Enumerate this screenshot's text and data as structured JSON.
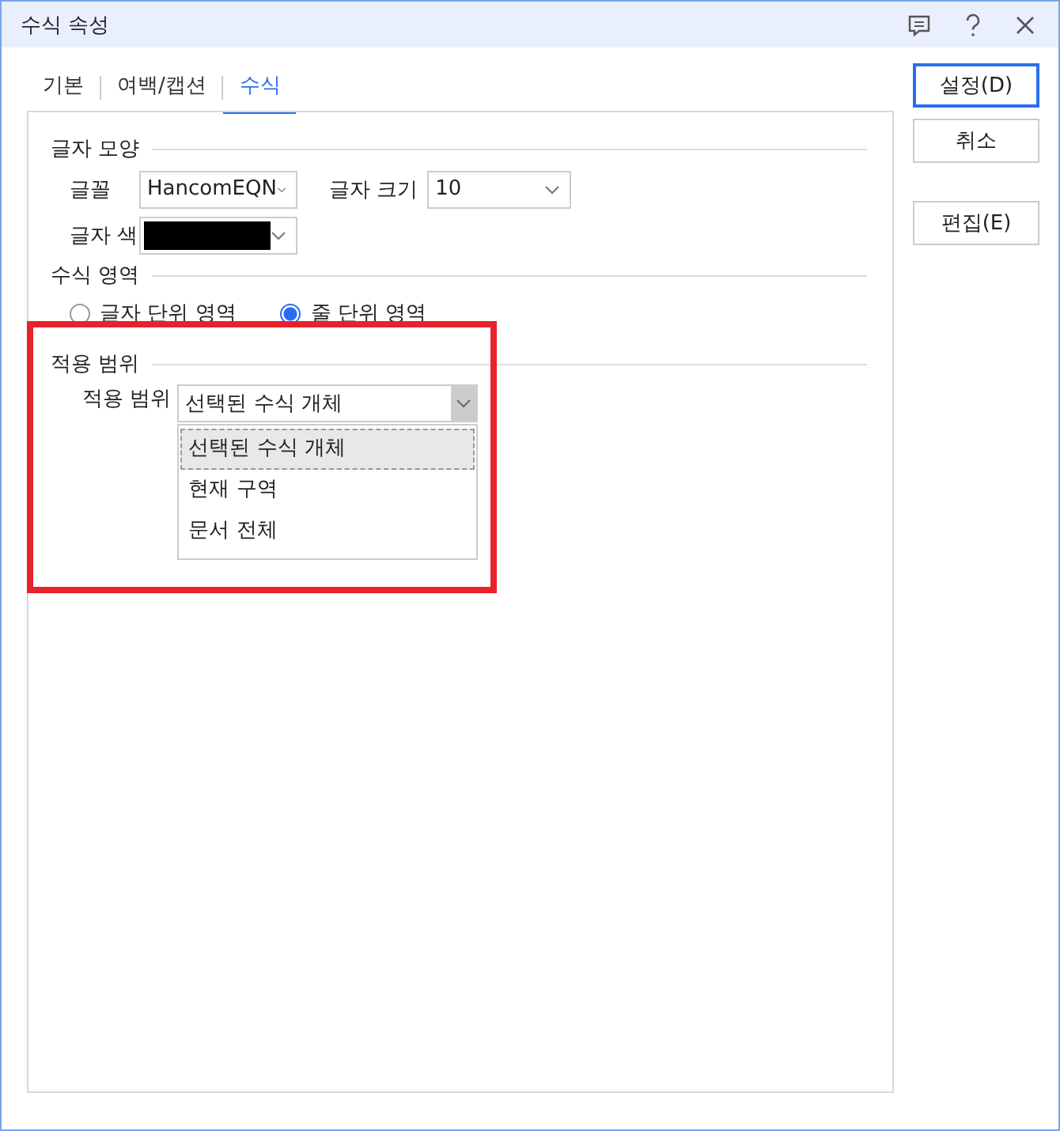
{
  "window": {
    "title": "수식 속성"
  },
  "tabs": [
    {
      "label": "기본",
      "selected": false
    },
    {
      "label": "여백/캡션",
      "selected": false
    },
    {
      "label": "수식",
      "selected": true
    }
  ],
  "font_shape": {
    "heading": "글자 모양",
    "font_label": "글꼴",
    "font_value": "HancomEQN",
    "size_label": "글자 크기",
    "size_value": "10",
    "color_label": "글자 색",
    "color": "#000000"
  },
  "formula_area": {
    "heading": "수식 영역",
    "options": [
      {
        "label": "글자 단위 영역",
        "selected": false
      },
      {
        "label": "줄 단위 영역",
        "selected": true
      }
    ]
  },
  "apply_range": {
    "heading": "적용 범위",
    "highlighted": true,
    "label": "적용 범위",
    "value": "선택된 수식 개체",
    "expanded": true,
    "options": [
      {
        "label": "선택된 수식 개체",
        "selected": true
      },
      {
        "label": "현재 구역",
        "selected": false
      },
      {
        "label": "문서 전체",
        "selected": false
      }
    ]
  },
  "buttons": [
    {
      "label": "설정(D)",
      "default": true
    },
    {
      "label": "취소",
      "default": false
    },
    {
      "label": "편집(E)",
      "default": false
    }
  ]
}
